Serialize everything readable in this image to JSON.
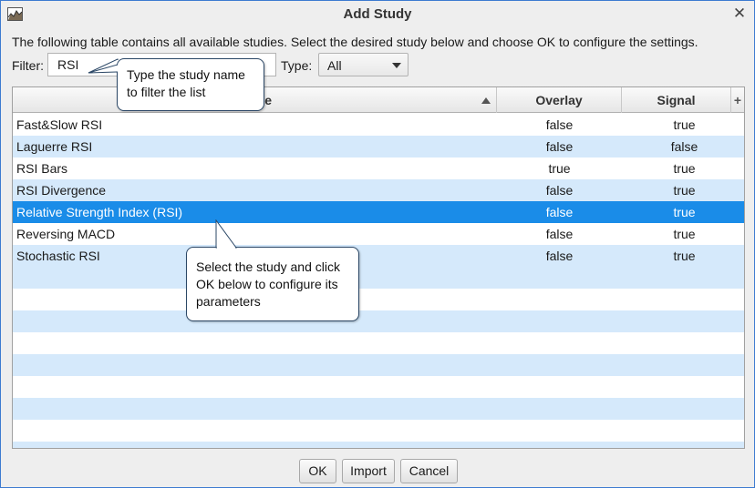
{
  "window": {
    "title": "Add Study",
    "close_glyph": "✕",
    "icon": "chart-app-icon"
  },
  "description": "The following table contains all available studies.  Select the desired study below and choose OK to configure the settings.",
  "filter": {
    "label": "Filter:",
    "value": "RSI"
  },
  "type": {
    "label": "Type:",
    "selected": "All"
  },
  "table": {
    "columns": {
      "name": "Name",
      "overlay": "Overlay",
      "signal": "Signal",
      "add": "+"
    },
    "sort": "ascending",
    "rows": [
      {
        "name": "Fast&Slow RSI",
        "overlay": "false",
        "signal": "true"
      },
      {
        "name": "Laguerre RSI",
        "overlay": "false",
        "signal": "false"
      },
      {
        "name": "RSI Bars",
        "overlay": "true",
        "signal": "true"
      },
      {
        "name": "RSI Divergence",
        "overlay": "false",
        "signal": "true"
      },
      {
        "name": "Relative Strength Index (RSI)",
        "overlay": "false",
        "signal": "true"
      },
      {
        "name": "Reversing MACD",
        "overlay": "false",
        "signal": "true"
      },
      {
        "name": "Stochastic RSI",
        "overlay": "false",
        "signal": "true"
      }
    ],
    "selected_index": 4
  },
  "buttons": {
    "ok": "OK",
    "import": "Import",
    "cancel": "Cancel"
  },
  "callouts": {
    "filter_hint": "Type the study name to filter the list",
    "select_hint": "Select the study and click OK below to configure its parameters"
  },
  "colors": {
    "selection": "#1a8ce8",
    "stripe": "#d5e9fb",
    "border_accent": "#3d7bd0"
  }
}
